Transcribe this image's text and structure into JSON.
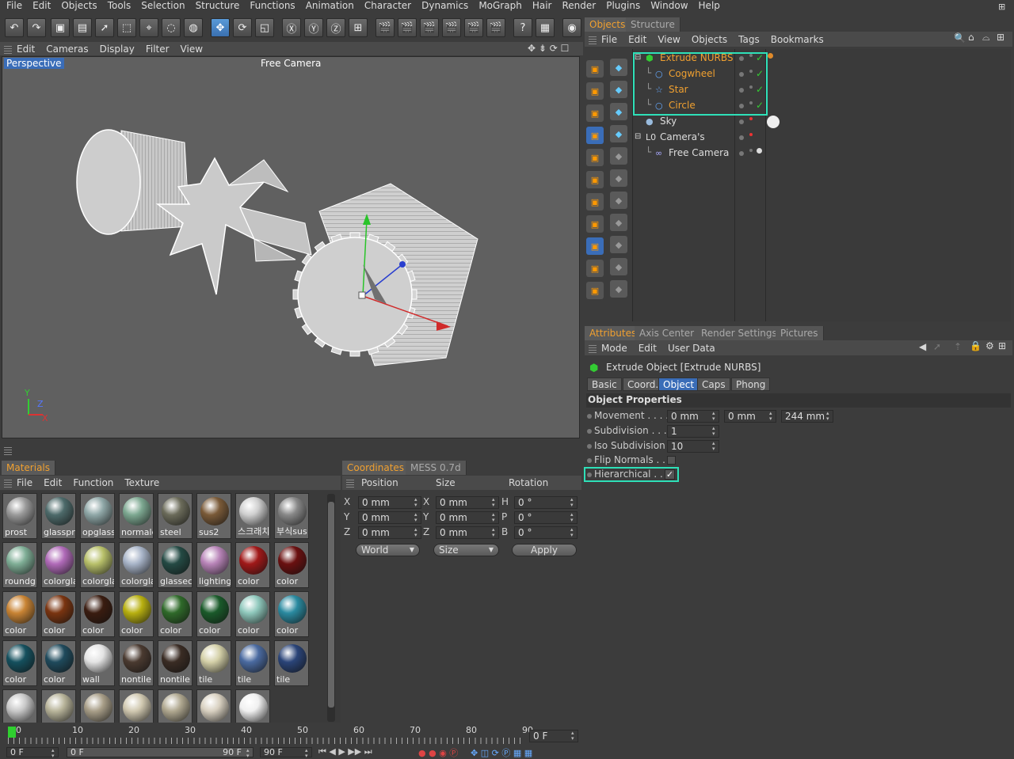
{
  "menu": [
    "File",
    "Edit",
    "Objects",
    "Tools",
    "Selection",
    "Structure",
    "Functions",
    "Animation",
    "Character",
    "Dynamics",
    "MoGraph",
    "Hair",
    "Render",
    "Plugins",
    "Window",
    "Help"
  ],
  "viewport": {
    "menu": [
      "Edit",
      "Cameras",
      "Display",
      "Filter",
      "View"
    ],
    "label_left": "Perspective",
    "label_center": "Free Camera",
    "axis": {
      "y": "Y",
      "z": "Z",
      "x": "X"
    }
  },
  "objects_panel": {
    "tabs": [
      "Objects",
      "Structure"
    ],
    "menu": [
      "File",
      "Edit",
      "View",
      "Objects",
      "Tags",
      "Bookmarks"
    ],
    "items": [
      {
        "name": "Extrude NURBS"
      },
      {
        "name": "Cogwheel"
      },
      {
        "name": "Star"
      },
      {
        "name": "Circle"
      },
      {
        "name": "Sky"
      },
      {
        "name": "Camera's"
      },
      {
        "name": "Free Camera"
      }
    ]
  },
  "attributes": {
    "tabs": [
      "Attributes",
      "Axis Center",
      "Render Settings",
      "Pictures"
    ],
    "menu": [
      "Mode",
      "Edit",
      "User Data"
    ],
    "object_title": "Extrude Object [Extrude NURBS]",
    "prop_tabs": [
      "Basic",
      "Coord.",
      "Object",
      "Caps",
      "Phong"
    ],
    "section": "Object Properties",
    "props": {
      "movement_label": "Movement . . . . .",
      "movement_x": "0 mm",
      "movement_y": "0 mm",
      "movement_z": "244 mm",
      "subdivision_label": "Subdivision . . . .",
      "subdivision": "1",
      "iso_label": "Iso Subdivision",
      "iso": "10",
      "flip_label": "Flip Normals . . .",
      "hier_label": "Hierarchical . . .",
      "hier_check": "✓"
    }
  },
  "materials": {
    "tabs": [
      "Materials"
    ],
    "menu": [
      "File",
      "Edit",
      "Function",
      "Texture"
    ],
    "items": [
      {
        "label": "prost",
        "color": "#9a9a9a"
      },
      {
        "label": "glasspr",
        "color": "#4d6a6a"
      },
      {
        "label": "opglass",
        "color": "#8fa7a7"
      },
      {
        "label": "normale",
        "color": "#7da891"
      },
      {
        "label": "steel",
        "color": "#6b6b5a"
      },
      {
        "label": "sus2",
        "color": "#7a5a38"
      },
      {
        "label": "스크래치",
        "color": "#cfcfcf"
      },
      {
        "label": "부식sus",
        "color": "#888888"
      },
      {
        "label": "roundgl",
        "color": "#7fae96"
      },
      {
        "label": "colorgla",
        "color": "#b06ab8"
      },
      {
        "label": "colorgla",
        "color": "#b8c06a"
      },
      {
        "label": "colorgla",
        "color": "#a8b4c8"
      },
      {
        "label": "glassec",
        "color": "#244a44"
      },
      {
        "label": "lighting",
        "color": "#b884b8"
      },
      {
        "label": "color",
        "color": "#a01818"
      },
      {
        "label": "color",
        "color": "#6a1010"
      },
      {
        "label": "color",
        "color": "#c98434"
      },
      {
        "label": "color",
        "color": "#7a3410"
      },
      {
        "label": "color",
        "color": "#3a1c10"
      },
      {
        "label": "color",
        "color": "#b8b010"
      },
      {
        "label": "color",
        "color": "#2f6a2a"
      },
      {
        "label": "color",
        "color": "#1a5a2a"
      },
      {
        "label": "color",
        "color": "#8fc8bc"
      },
      {
        "label": "color",
        "color": "#2a8aa0"
      },
      {
        "label": "color",
        "color": "#15505e"
      },
      {
        "label": "color",
        "color": "#1f4a5c"
      },
      {
        "label": "wall",
        "color": "#e4e4e4"
      },
      {
        "label": "nontile",
        "color": "#4a3a30"
      },
      {
        "label": "nontile",
        "color": "#3a2c24"
      },
      {
        "label": "tile",
        "color": "#d4d0a8"
      },
      {
        "label": "tile",
        "color": "#4a6aa0"
      },
      {
        "label": "tile",
        "color": "#2a4478"
      },
      {
        "label": "",
        "color": "#c8c8c8"
      },
      {
        "label": "",
        "color": "#b8b49a"
      },
      {
        "label": "",
        "color": "#a89e88"
      },
      {
        "label": "",
        "color": "#d0c8b0"
      },
      {
        "label": "",
        "color": "#b0a890"
      },
      {
        "label": "",
        "color": "#d8d0c0"
      },
      {
        "label": "",
        "color": "#f0f0f0"
      }
    ]
  },
  "coordinates": {
    "tabs": [
      "Coordinates",
      "MESS 0.7d"
    ],
    "headers": [
      "Position",
      "Size",
      "Rotation"
    ],
    "pos": [
      {
        "axis": "X",
        "value": "0 mm"
      },
      {
        "axis": "Y",
        "value": "0 mm"
      },
      {
        "axis": "Z",
        "value": "0 mm"
      }
    ],
    "size": [
      {
        "axis": "X",
        "value": "0 mm"
      },
      {
        "axis": "Y",
        "value": "0 mm"
      },
      {
        "axis": "Z",
        "value": "0 mm"
      }
    ],
    "rot": [
      {
        "axis": "H",
        "value": "0 °"
      },
      {
        "axis": "P",
        "value": "0 °"
      },
      {
        "axis": "B",
        "value": "0 °"
      }
    ],
    "world": "World",
    "size_mode": "Size",
    "apply": "Apply"
  },
  "timeline": {
    "ticks": [
      "0",
      "10",
      "20",
      "30",
      "40",
      "50",
      "60",
      "70",
      "80",
      "90"
    ],
    "current": "0 F",
    "start": "0 F",
    "range_start": "0 F",
    "range_end": "90 F",
    "end": "90 F"
  },
  "colors": {
    "accent_orange": "#f0a030",
    "highlight_teal": "#2ee0b8",
    "check_green": "#33cc33",
    "selected_blue": "#3a6db8"
  }
}
